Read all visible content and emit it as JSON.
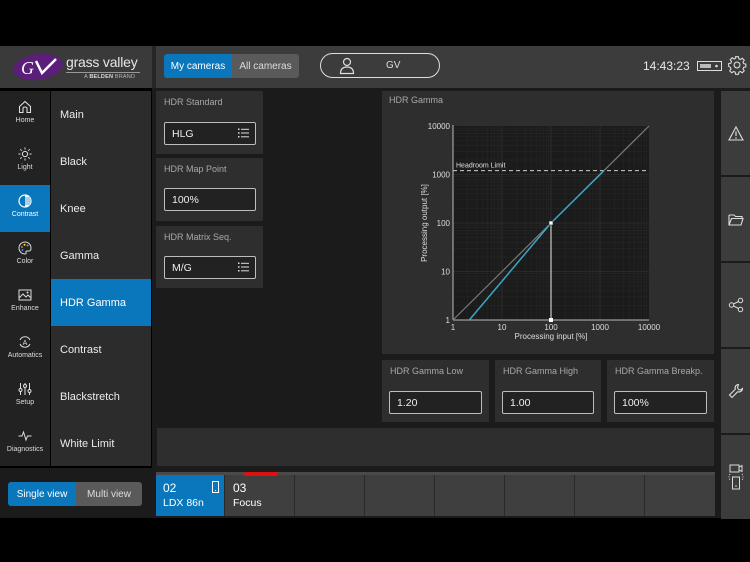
{
  "header": {
    "brand_name": "grass valley",
    "brand_sub_prefix": "A",
    "brand_sub_bold": "BELDEN",
    "brand_sub_suffix": "BRAND",
    "camera_filter": [
      "My cameras",
      "All cameras"
    ],
    "camera_filter_selected": "My cameras",
    "user_label": "GV",
    "clock": "14:43:23"
  },
  "nav": {
    "items": [
      {
        "label": "Home",
        "icon": "home-icon"
      },
      {
        "label": "Light",
        "icon": "sun-icon"
      },
      {
        "label": "Contrast",
        "icon": "contrast-icon"
      },
      {
        "label": "Color",
        "icon": "palette-icon"
      },
      {
        "label": "Enhance",
        "icon": "image-icon"
      },
      {
        "label": "Automatics",
        "icon": "automatics-icon"
      },
      {
        "label": "Setup",
        "icon": "sliders-icon"
      },
      {
        "label": "Diagnostics",
        "icon": "pulse-icon"
      }
    ],
    "active": "Contrast"
  },
  "submenu": {
    "items": [
      "Main",
      "Black",
      "Knee",
      "Gamma",
      "HDR Gamma",
      "Contrast",
      "Blackstretch",
      "White Limit"
    ],
    "active": "HDR Gamma"
  },
  "params": {
    "hdr_standard": {
      "label": "HDR Standard",
      "value": "HLG"
    },
    "hdr_map_point": {
      "label": "HDR Map Point",
      "value": "100%"
    },
    "hdr_matrix_seq": {
      "label": "HDR Matrix Seq.",
      "value": "M/G"
    },
    "hdr_gamma_low": {
      "label": "HDR Gamma Low",
      "value": "1.20"
    },
    "hdr_gamma_high": {
      "label": "HDR Gamma High",
      "value": "1.00"
    },
    "hdr_gamma_breakpoint": {
      "label": "HDR Gamma Breakp.",
      "value": "100%"
    }
  },
  "chart_data": {
    "type": "line",
    "title": "HDR Gamma",
    "xlabel": "Processing input [%]",
    "ylabel": "Processing output [%]",
    "xscale": "log",
    "yscale": "log",
    "xlim": [
      1,
      10000
    ],
    "ylim": [
      1,
      10000
    ],
    "xticks": [
      "1",
      "10",
      "100",
      "1000",
      "10000"
    ],
    "yticks": [
      "1",
      "10",
      "100",
      "1000",
      "10000"
    ],
    "grid": true,
    "annotations": [
      {
        "text": "Headroom Limit",
        "type": "hline",
        "y": 1200,
        "style": "dashed"
      }
    ],
    "breakpoint": {
      "x": 100,
      "y": 100
    },
    "series": [
      {
        "name": "reference",
        "color": "#7a7a7a",
        "x": [
          1,
          10000
        ],
        "y": [
          1,
          10000
        ]
      },
      {
        "name": "hdr-gamma-curve",
        "color": "#3aa6c4",
        "x": [
          2.15,
          10,
          100,
          1200
        ],
        "y": [
          1,
          6.3,
          100,
          1200
        ]
      }
    ]
  },
  "right_toolbar": [
    {
      "icon": "warning-icon"
    },
    {
      "icon": "folder-icon"
    },
    {
      "icon": "share-icon"
    },
    {
      "icon": "wrench-icon"
    },
    {
      "icon": "camera-link-icon"
    }
  ],
  "footer": {
    "view_mode": [
      "Single view",
      "Multi view"
    ],
    "view_mode_selected": "Single view",
    "cameras": [
      {
        "number": "02",
        "name": "LDX 86n",
        "active": true,
        "tally": false
      },
      {
        "number": "03",
        "name": "Focus",
        "active": false,
        "tally": true
      },
      {
        "number": "",
        "name": "",
        "active": false,
        "tally": false
      },
      {
        "number": "",
        "name": "",
        "active": false,
        "tally": false
      },
      {
        "number": "",
        "name": "",
        "active": false,
        "tally": false
      },
      {
        "number": "",
        "name": "",
        "active": false,
        "tally": false
      },
      {
        "number": "",
        "name": "",
        "active": false,
        "tally": false
      },
      {
        "number": "",
        "name": "",
        "active": false,
        "tally": false
      }
    ]
  },
  "colors": {
    "accent": "#0a77bd",
    "tally": "#e01010",
    "curve": "#3aa6c4"
  }
}
